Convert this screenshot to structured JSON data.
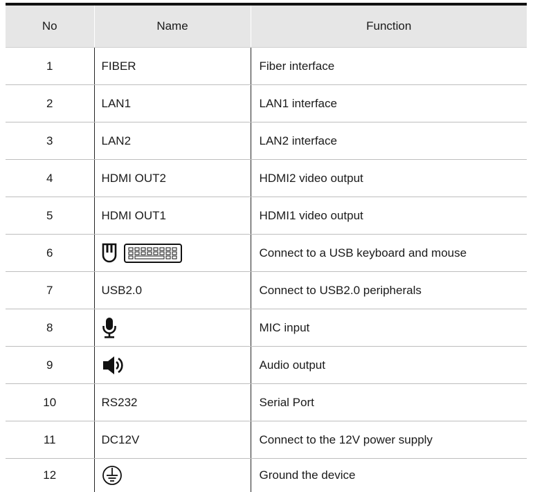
{
  "table": {
    "headers": {
      "no": "No",
      "name": "Name",
      "function": "Function"
    },
    "rows": [
      {
        "no": "1",
        "name": "FIBER",
        "function": "Fiber interface"
      },
      {
        "no": "2",
        "name": "LAN1",
        "function": "LAN1 interface"
      },
      {
        "no": "3",
        "name": "LAN2",
        "function": "LAN2 interface"
      },
      {
        "no": "4",
        "name": "HDMI OUT2",
        "function": "HDMI2 video output"
      },
      {
        "no": "5",
        "name": "HDMI OUT1",
        "function": "HDMI1 video output"
      },
      {
        "no": "6",
        "name_icons": [
          "mouse-icon",
          "keyboard-icon"
        ],
        "function": "Connect to a USB keyboard and mouse"
      },
      {
        "no": "7",
        "name": "USB2.0",
        "function": "Connect to USB2.0 peripherals"
      },
      {
        "no": "8",
        "name_icons": [
          "microphone-icon"
        ],
        "function": "MIC input"
      },
      {
        "no": "9",
        "name_icons": [
          "speaker-icon"
        ],
        "function": "Audio output"
      },
      {
        "no": "10",
        "name": "RS232",
        "function": "Serial Port"
      },
      {
        "no": "11",
        "name": "DC12V",
        "function": "Connect to the 12V power supply"
      },
      {
        "no": "12",
        "name_icons": [
          "ground-icon"
        ],
        "function": "Ground the device"
      }
    ]
  },
  "colors": {
    "header_bg": "#e6e6e6",
    "top_rule": "#111111",
    "row_divider": "#bdbdbd",
    "text": "#1a1a1a"
  }
}
